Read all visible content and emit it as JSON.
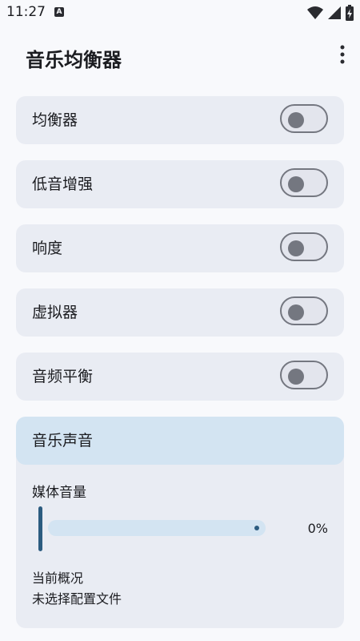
{
  "status_bar": {
    "time": "11:27",
    "notification_letter": "A"
  },
  "app_bar": {
    "title": "音乐均衡器"
  },
  "settings": [
    {
      "label": "均衡器",
      "enabled": false
    },
    {
      "label": "低音增强",
      "enabled": false
    },
    {
      "label": "响度",
      "enabled": false
    },
    {
      "label": "虚拟器",
      "enabled": false
    },
    {
      "label": "音频平衡",
      "enabled": false
    }
  ],
  "music_sound": {
    "header": "音乐声音",
    "media_volume_label": "媒体音量",
    "media_volume_value": "0%",
    "media_volume_level": 0,
    "profile_title": "当前概况",
    "profile_value": "未选择配置文件"
  },
  "colors": {
    "background": "#f8f9fc",
    "card": "#e9ecf3",
    "header_accent": "#d3e4f2",
    "slider_accent": "#2c5c80",
    "switch_outline": "#747780"
  },
  "icons": [
    "notification-a-icon",
    "wifi-icon",
    "signal-icon",
    "battery-charging-icon",
    "more-vert-icon"
  ]
}
